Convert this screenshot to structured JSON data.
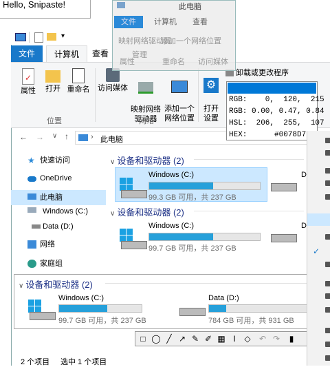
{
  "hello": {
    "text": "Hello, Snipaste!"
  },
  "ghost": {
    "title": "此电脑",
    "tabs": [
      "文件",
      "计算机",
      "查看"
    ],
    "buttons": [
      "映射网络驱动器",
      "添加一个网络位置",
      "打开设置",
      "属性",
      "管理",
      "重命名",
      "访问媒体",
      "映"
    ]
  },
  "ribbon": {
    "tabs": [
      "文件",
      "计算机",
      "查看"
    ],
    "buttons": {
      "properties": "属性",
      "open": "打开",
      "rename": "重命名",
      "media": "访问媒体",
      "map_drive": "映射网络\n驱动器",
      "add_location": "添加一个\n网络位置",
      "open_settings": "打开\n设置",
      "uninstall": "卸载或更改程序"
    },
    "groups": [
      "位置",
      "网络"
    ]
  },
  "address": {
    "path": "此电脑"
  },
  "nav": {
    "items": [
      "快速访问",
      "OneDrive",
      "此电脑",
      "Windows (C:)",
      "Data (D:)",
      "网络",
      "家庭组"
    ]
  },
  "main": {
    "section": "设备和驱动器 (2)",
    "drives": [
      {
        "name": "Windows (C:)",
        "size": "99.3 GB 可用，共 237 GB",
        "used": 0.58
      },
      {
        "name": "Windows (C:)",
        "size": "99.7 GB 可用，共 237 GB",
        "used": 0.58
      },
      {
        "name": "Data (D:)",
        "size": "784 GB 可用，共 931 GB",
        "used": 0.16
      }
    ],
    "partial_drive_letter": "D"
  },
  "lower": {
    "section": "设备和驱动器 (2)"
  },
  "status": {
    "count": "2 个项目",
    "selected": "选中 1 个项目"
  },
  "color_popup": {
    "rgb_int": "RGB:    0,  120,  215",
    "rgb_float": "RGB: 0.00, 0.47, 0.84",
    "hsl": "HSL:  206,  255,  107",
    "hex": "HEX:      #0078D7",
    "swatch": "#0078D7"
  },
  "colors": {
    "accent": "#0078D7",
    "bar": "#26a0da",
    "selection": "#cce8ff"
  }
}
